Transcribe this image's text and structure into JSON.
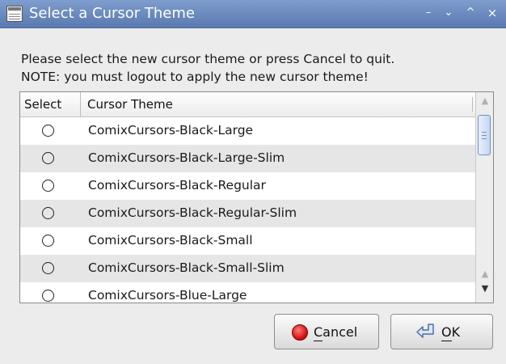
{
  "window": {
    "title": "Select a Cursor Theme",
    "controls": {
      "minimize": "–",
      "shade": "⌄",
      "maximize": "^",
      "close": "×"
    }
  },
  "message": {
    "line1": "Please select the new cursor theme or press Cancel to quit.",
    "line2": "NOTE: you must logout to apply the new cursor theme!"
  },
  "list": {
    "columns": [
      "Select",
      "Cursor Theme"
    ],
    "rows": [
      {
        "theme": "ComixCursors-Black-Large",
        "selected": false
      },
      {
        "theme": "ComixCursors-Black-Large-Slim",
        "selected": false
      },
      {
        "theme": "ComixCursors-Black-Regular",
        "selected": false
      },
      {
        "theme": "ComixCursors-Black-Regular-Slim",
        "selected": false
      },
      {
        "theme": "ComixCursors-Black-Small",
        "selected": false
      },
      {
        "theme": "ComixCursors-Black-Small-Slim",
        "selected": false
      },
      {
        "theme": "ComixCursors-Blue-Large",
        "selected": false
      }
    ]
  },
  "buttons": {
    "cancel": {
      "first": "C",
      "rest": "ancel",
      "icon": "stop-icon"
    },
    "ok": {
      "first": "O",
      "rest": "K",
      "icon": "enter-arrow-icon"
    }
  },
  "colors": {
    "titlebar": "#6c8bbf",
    "background": "#ececec",
    "row_alt": "#e6e6e6",
    "cancel_icon": "#d31010"
  }
}
